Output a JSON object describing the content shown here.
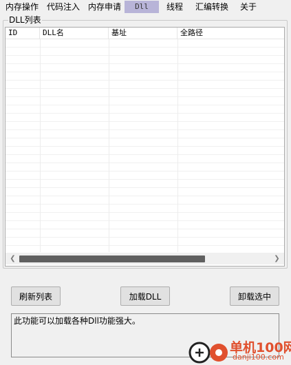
{
  "tabs": [
    {
      "label": "内存操作",
      "active": false
    },
    {
      "label": "代码注入",
      "active": false
    },
    {
      "label": "内存申请",
      "active": false
    },
    {
      "label": "Dll",
      "active": true
    },
    {
      "label": "线程",
      "active": false
    },
    {
      "label": "汇编转换",
      "active": false
    },
    {
      "label": "关于",
      "active": false
    }
  ],
  "group_title": "DLL列表",
  "columns": [
    "ID",
    "DLL名",
    "基址",
    "全路径"
  ],
  "rows": [],
  "scrollbar": {
    "left_icon": "chevron-left-icon",
    "right_icon": "chevron-right-icon"
  },
  "buttons": {
    "refresh": "刷新列表",
    "load": "加载DLL",
    "unload": "卸载选中"
  },
  "description": "此功能可以加载各种Dll功能强大。",
  "watermark": {
    "site_name": "单机100网",
    "url": "danji100.com"
  },
  "colors": {
    "active_tab": "#b8b4d8",
    "watermark": "#e0502e"
  }
}
